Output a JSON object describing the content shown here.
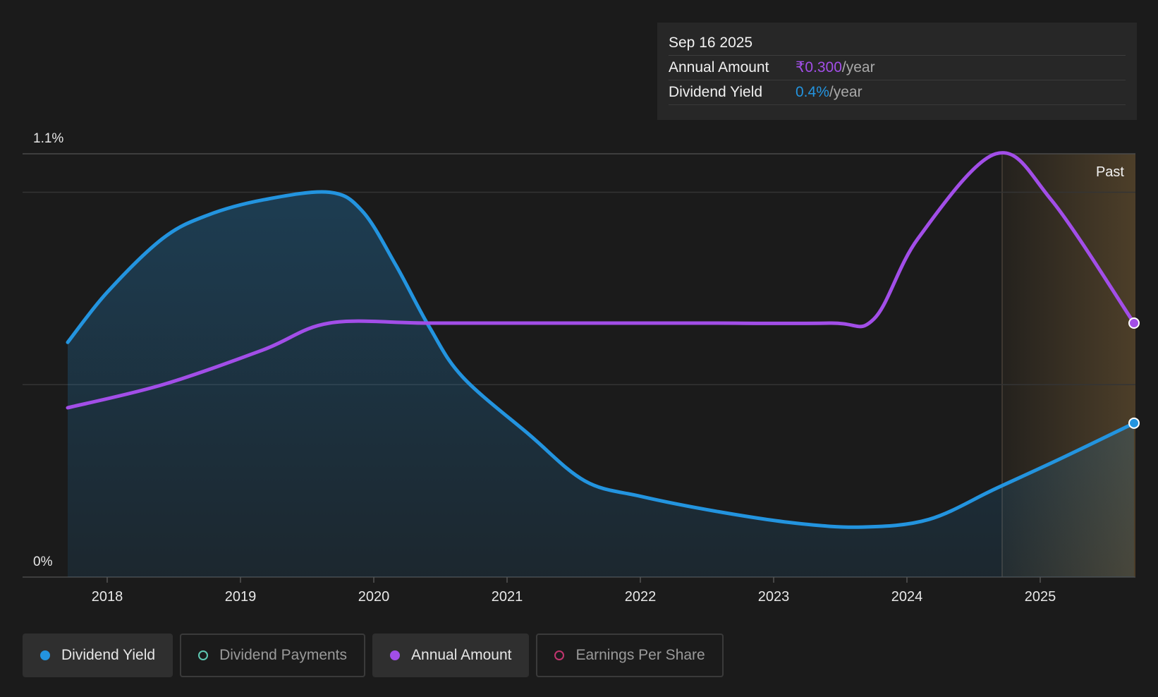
{
  "chart_data": {
    "type": "line",
    "x_ticks": [
      "2018",
      "2019",
      "2020",
      "2021",
      "2022",
      "2023",
      "2024",
      "2025"
    ],
    "y_tick_labels": [
      "1.1%",
      "0%"
    ],
    "ylim": [
      0,
      1.1
    ],
    "forecast_label": "Past",
    "series": [
      {
        "name": "Dividend Yield",
        "color": "#2394df",
        "fill": true,
        "points": [
          [
            "2017-09",
            0.61
          ],
          [
            "2018-01",
            0.74
          ],
          [
            "2018-06",
            0.88
          ],
          [
            "2018-10",
            0.94
          ],
          [
            "2019-03",
            0.98
          ],
          [
            "2019-09",
            1.0
          ],
          [
            "2019-12",
            0.95
          ],
          [
            "2020-03",
            0.81
          ],
          [
            "2020-06",
            0.65
          ],
          [
            "2020-09",
            0.52
          ],
          [
            "2021-03",
            0.37
          ],
          [
            "2021-08",
            0.25
          ],
          [
            "2022-01",
            0.21
          ],
          [
            "2022-08",
            0.17
          ],
          [
            "2023-03",
            0.14
          ],
          [
            "2023-09",
            0.13
          ],
          [
            "2024-03",
            0.15
          ],
          [
            "2024-09",
            0.23
          ],
          [
            "2025-03",
            0.31
          ],
          [
            "2025-09",
            0.4
          ]
        ]
      },
      {
        "name": "Annual Amount",
        "color": "#a24ee8",
        "fill": false,
        "points": [
          [
            "2017-09",
            0.44
          ],
          [
            "2018-06",
            0.5
          ],
          [
            "2019-03",
            0.59
          ],
          [
            "2019-09",
            0.66
          ],
          [
            "2020-06",
            0.66
          ],
          [
            "2021-06",
            0.66
          ],
          [
            "2022-06",
            0.66
          ],
          [
            "2023-06",
            0.66
          ],
          [
            "2023-10",
            0.67
          ],
          [
            "2024-02",
            0.88
          ],
          [
            "2024-09",
            1.1
          ],
          [
            "2025-02",
            0.98
          ],
          [
            "2025-09",
            0.66
          ]
        ]
      }
    ]
  },
  "tooltip": {
    "date": "Sep 16 2025",
    "rows": [
      {
        "label": "Annual Amount",
        "value": "₹0.300",
        "unit": "/year",
        "color": "#a24ee8"
      },
      {
        "label": "Dividend Yield",
        "value": "0.4%",
        "unit": "/year",
        "color": "#2394df"
      }
    ]
  },
  "legend": [
    {
      "label": "Dividend Yield",
      "color": "#2394df",
      "active": true
    },
    {
      "label": "Dividend Payments",
      "color": "#5ec8b2",
      "active": false
    },
    {
      "label": "Annual Amount",
      "color": "#a24ee8",
      "active": true
    },
    {
      "label": "Earnings Per Share",
      "color": "#c2356f",
      "active": false
    }
  ]
}
